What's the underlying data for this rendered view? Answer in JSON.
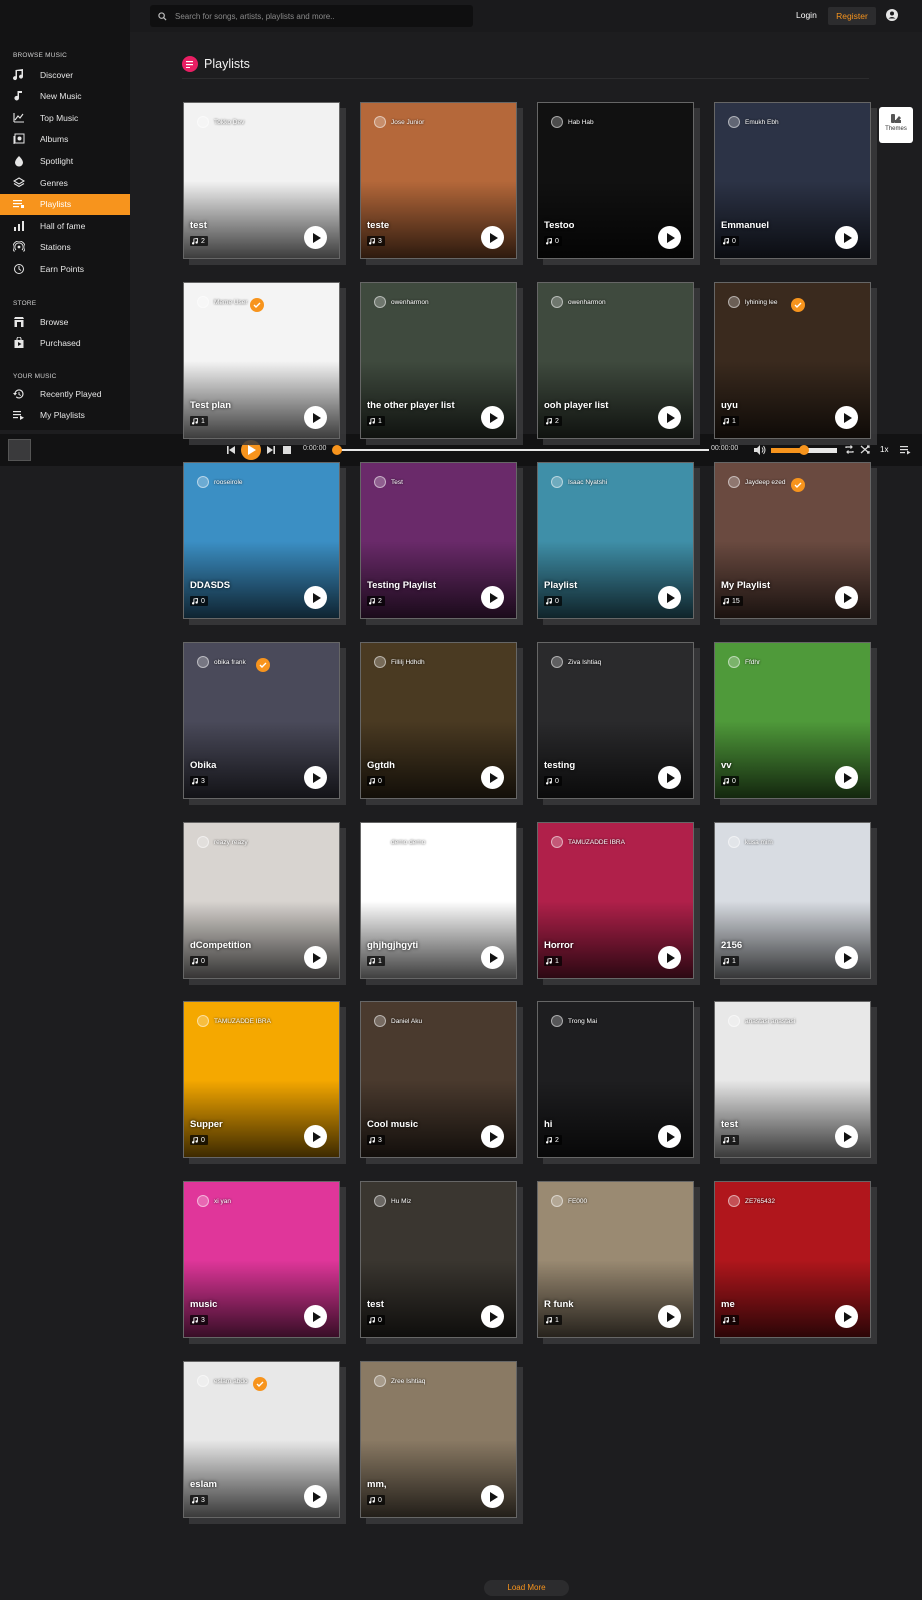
{
  "search": {
    "placeholder": "Search for songs, artists, playlists and more.."
  },
  "header": {
    "login": "Login",
    "register": "Register"
  },
  "sidebar": {
    "browse_title": "BROWSE MUSIC",
    "browse": [
      {
        "label": "Discover",
        "icon": "music-note-icon"
      },
      {
        "label": "New Music",
        "icon": "single-note-icon"
      },
      {
        "label": "Top Music",
        "icon": "trending-chart-icon"
      },
      {
        "label": "Albums",
        "icon": "album-icon"
      },
      {
        "label": "Spotlight",
        "icon": "spotlight-icon"
      },
      {
        "label": "Genres",
        "icon": "layers-icon"
      },
      {
        "label": "Playlists",
        "icon": "playlist-icon",
        "active": true
      },
      {
        "label": "Hall of fame",
        "icon": "bar-chart-icon"
      },
      {
        "label": "Stations",
        "icon": "radio-icon"
      },
      {
        "label": "Earn Points",
        "icon": "points-icon"
      }
    ],
    "store_title": "STORE",
    "store": [
      {
        "label": "Browse",
        "icon": "store-icon"
      },
      {
        "label": "Purchased",
        "icon": "bag-icon"
      }
    ],
    "your_title": "YOUR MUSIC",
    "your": [
      {
        "label": "Recently Played",
        "icon": "history-icon"
      },
      {
        "label": "My Playlists",
        "icon": "queue-icon"
      }
    ]
  },
  "player": {
    "current_time": "0:00:00",
    "total_time": "00:00:00",
    "speed": "1x",
    "progress": 0,
    "volume": 0.5
  },
  "page": {
    "title": "Playlists",
    "themes_label": "Themes",
    "load_more": "Load More"
  },
  "colors": {
    "accent": "#f7941d",
    "background": "#1d1d1f",
    "sidebar": "#131314",
    "heading_icon": "#e91e63"
  },
  "playlists": [
    {
      "owner": "Tokko Dev",
      "name": "test",
      "count": "2",
      "verified": false,
      "bg": "#f2f2f2"
    },
    {
      "owner": "Jose Junior",
      "name": "teste",
      "count": "3",
      "verified": false,
      "bg": "#b5683a"
    },
    {
      "owner": "Hab Hab",
      "name": "Testoo",
      "count": "0",
      "verified": false,
      "bg": "#111111"
    },
    {
      "owner": "Emukh Ebh",
      "name": "Emmanuel",
      "count": "0",
      "verified": false,
      "bg": "#2c3346"
    },
    {
      "owner": "Meme User",
      "name": "Test plan",
      "count": "1",
      "verified": true,
      "bg": "#f4f4f4"
    },
    {
      "owner": "owenharmon",
      "name": "the other player list",
      "count": "1",
      "verified": false,
      "bg": "#3f4a3e"
    },
    {
      "owner": "owenharmon",
      "name": "ooh player list",
      "count": "2",
      "verified": false,
      "bg": "#3f4a3e"
    },
    {
      "owner": "lyhining lee",
      "name": "uyu",
      "count": "1",
      "verified": true,
      "bg": "#3a2a1e"
    },
    {
      "owner": "rooseirole",
      "name": "DDASDS",
      "count": "0",
      "verified": false,
      "bg": "#3b8fc4"
    },
    {
      "owner": "Test",
      "name": "Testing Playlist",
      "count": "2",
      "verified": false,
      "bg": "#6a2a6a"
    },
    {
      "owner": "Isaac Nyatshi",
      "name": "Playlist",
      "count": "0",
      "verified": false,
      "bg": "#3f8fa8"
    },
    {
      "owner": "Jaydeep ezed",
      "name": "My Playlist",
      "count": "15",
      "verified": true,
      "bg": "#6a4a40"
    },
    {
      "owner": "obika frank",
      "name": "Obika",
      "count": "3",
      "verified": true,
      "bg": "#4a4a5a"
    },
    {
      "owner": "Fillilj Hdhdh",
      "name": "Ggtdh",
      "count": "0",
      "verified": false,
      "bg": "#4a3a22"
    },
    {
      "owner": "Ziva Ishtiaq",
      "name": "testing",
      "count": "0",
      "verified": false,
      "bg": "#2a2a2c"
    },
    {
      "owner": "Ffdhr",
      "name": "vv",
      "count": "0",
      "verified": false,
      "bg": "#4f9a3a"
    },
    {
      "owner": "reazy reazy",
      "name": "dCompetition",
      "count": "0",
      "verified": false,
      "bg": "#d8d4d0"
    },
    {
      "owner": "demo demo",
      "name": "ghjhgjhgyti",
      "count": "1",
      "verified": false,
      "bg": "#ffffff"
    },
    {
      "owner": "TAMUZADDE IBRA",
      "name": "Horror",
      "count": "1",
      "verified": false,
      "bg": "#b0204a"
    },
    {
      "owner": "kusa mim",
      "name": "2156",
      "count": "1",
      "verified": false,
      "bg": "#d8dce2"
    },
    {
      "owner": "TAMUZADDE IBRA",
      "name": "Supper",
      "count": "0",
      "verified": false,
      "bg": "#f5a800"
    },
    {
      "owner": "Daniel Aku",
      "name": "Cool music",
      "count": "3",
      "verified": false,
      "bg": "#4a3a2e"
    },
    {
      "owner": "Trong Mai",
      "name": "hi",
      "count": "2",
      "verified": false,
      "bg": "#1e1e20"
    },
    {
      "owner": "anastasi anastasi",
      "name": "test",
      "count": "1",
      "verified": false,
      "bg": "#e8e8e8"
    },
    {
      "owner": "xi yan",
      "name": "music",
      "count": "3",
      "verified": false,
      "bg": "#e0369a"
    },
    {
      "owner": "Hu Miz",
      "name": "test",
      "count": "0",
      "verified": false,
      "bg": "#3a3630"
    },
    {
      "owner": "FE000",
      "name": "R funk",
      "count": "1",
      "verified": false,
      "bg": "#9a8a72"
    },
    {
      "owner": "ZE765432",
      "name": "me",
      "count": "1",
      "verified": false,
      "bg": "#b0161c"
    },
    {
      "owner": "eslam abdo",
      "name": "eslam",
      "count": "3",
      "verified": true,
      "bg": "#e8e8e8"
    },
    {
      "owner": "Zree Ishtiaq",
      "name": "mm,",
      "count": "0",
      "verified": false,
      "bg": "#8a7a64"
    }
  ]
}
